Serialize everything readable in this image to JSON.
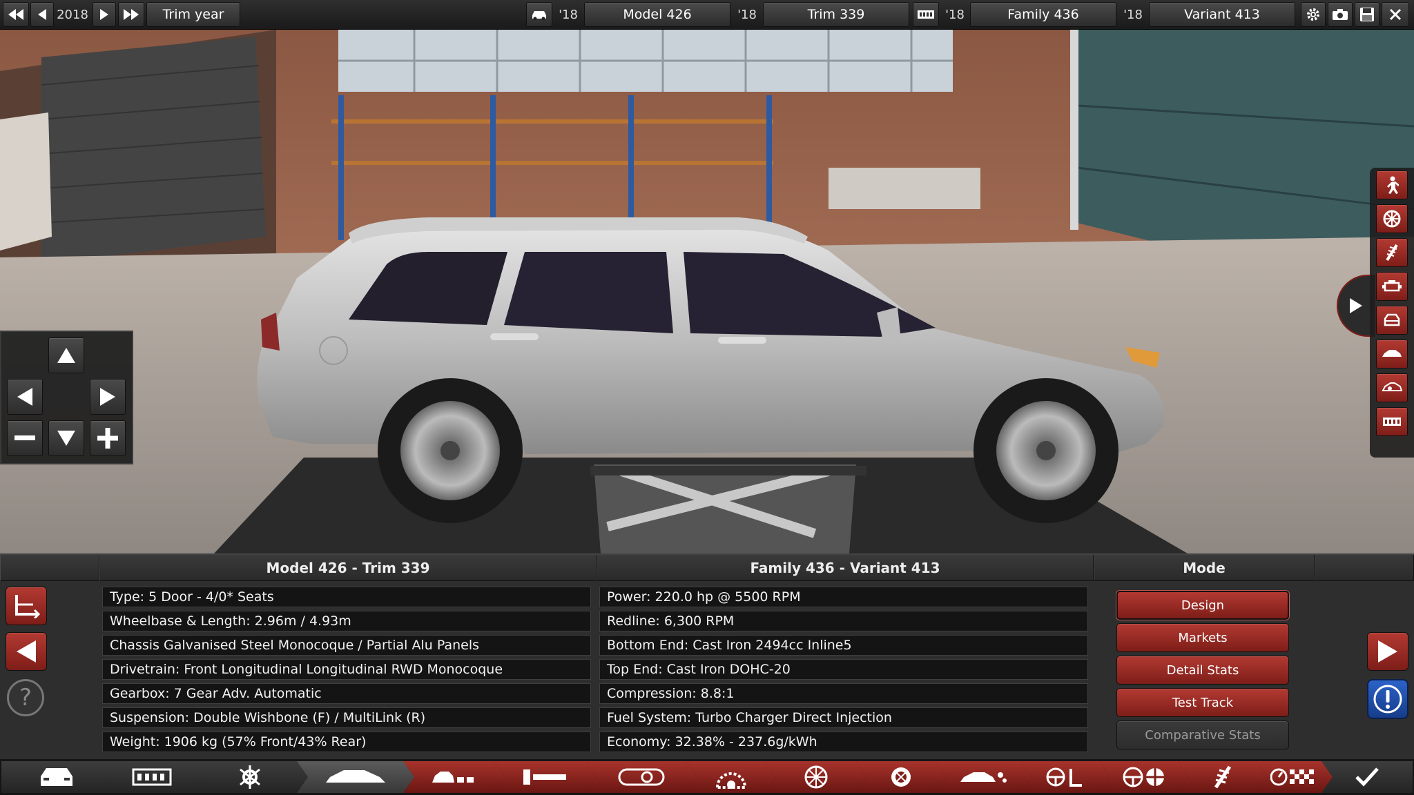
{
  "topbar": {
    "year": "2018",
    "trim_year_label": "Trim year",
    "model_year": "'18",
    "model_label": "Model 426",
    "trim_year": "'18",
    "trim_label": "Trim 339",
    "family_year": "'18",
    "family_label": "Family 436",
    "variant_year": "'18",
    "variant_label": "Variant 413"
  },
  "left_panel": {
    "header": "Model 426 - Trim 339",
    "rows": [
      "Type: 5 Door - 4/0* Seats",
      "Wheelbase & Length: 2.96m / 4.93m",
      "Chassis Galvanised Steel Monocoque / Partial Alu Panels",
      "Drivetrain: Front Longitudinal Longitudinal RWD Monocoque",
      "Gearbox: 7 Gear Adv. Automatic",
      "Suspension: Double Wishbone (F) / MultiLink (R)",
      "Weight: 1906 kg (57% Front/43% Rear)"
    ]
  },
  "right_panel": {
    "header": "Family 436 - Variant 413",
    "rows": [
      "Power: 220.0 hp @ 5500 RPM",
      "Redline:  6,300 RPM",
      "Bottom End: Cast Iron 2494cc Inline5",
      "Top End: Cast Iron DOHC-20",
      "Compression: 8.8:1",
      "Fuel System: Turbo Charger Direct Injection",
      "Economy: 32.38% - 237.6g/kWh"
    ]
  },
  "mode_panel": {
    "header": "Mode",
    "buttons": [
      "Design",
      "Markets",
      "Detail Stats",
      "Test Track",
      "Comparative Stats"
    ]
  },
  "colors": {
    "accent_red": "#9b2d26",
    "panel_bg": "#2e2e2e",
    "row_bg": "#141414"
  },
  "icons": {
    "top_left": [
      "rewind-icon",
      "prev-icon",
      "play-icon",
      "fast-forward-icon"
    ],
    "top_right": [
      "gear-icon",
      "camera-icon",
      "save-icon",
      "close-icon"
    ],
    "side": [
      "person-icon",
      "wheel-icon",
      "spring-icon",
      "engine-icon",
      "car-front-icon",
      "car-side-icon",
      "car-interior-icon",
      "engine-block-icon"
    ],
    "tabs": [
      "car-front-tab",
      "engine-block-tab",
      "gears-tab",
      "body-tab",
      "car-family-tab",
      "frame-tab",
      "engine-tab",
      "turbo-tab",
      "wheel-tab",
      "brake-tab",
      "car-fixture-tab",
      "steering-tab",
      "rims-tab",
      "spring-tab",
      "test-track-tab",
      "confirm-tab"
    ]
  }
}
